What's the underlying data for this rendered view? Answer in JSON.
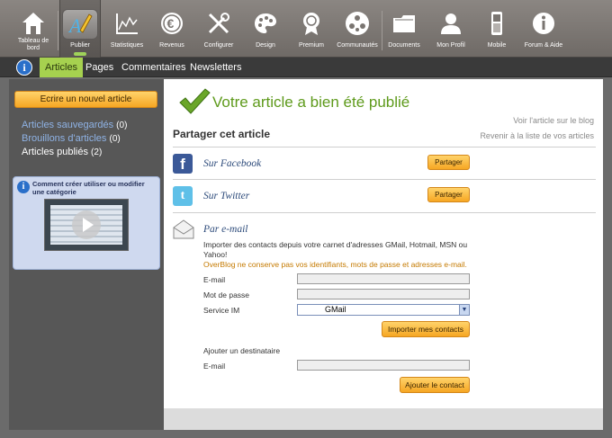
{
  "toolbar": {
    "items": [
      {
        "label": "Tableau de bord",
        "icon": "house-icon"
      },
      {
        "label": "Publier",
        "icon": "pencil-icon",
        "active": true
      },
      {
        "label": "Statistiques",
        "icon": "chart-icon"
      },
      {
        "label": "Revenus",
        "icon": "euro-icon"
      },
      {
        "label": "Configurer",
        "icon": "tools-icon"
      },
      {
        "label": "Design",
        "icon": "palette-icon"
      },
      {
        "label": "Premium",
        "icon": "medal-icon"
      },
      {
        "label": "Communautés",
        "icon": "community-icon"
      },
      {
        "label": "Documents",
        "icon": "folder-icon"
      },
      {
        "label": "Mon Profil",
        "icon": "user-icon"
      },
      {
        "label": "Mobile",
        "icon": "phone-icon"
      },
      {
        "label": "Forum & Aide",
        "icon": "info-icon"
      }
    ]
  },
  "subnav": {
    "info": "i",
    "tabs": [
      {
        "label": "Articles",
        "active": true
      },
      {
        "label": "Pages"
      },
      {
        "label": "Commentaires"
      },
      {
        "label": "Newsletters"
      }
    ]
  },
  "sidebar": {
    "new_button": "Ecrire un nouvel article",
    "links": [
      {
        "label": "Articles sauvegardés",
        "count": "(0)"
      },
      {
        "label": "Brouillons d'articles",
        "count": "(0)"
      },
      {
        "label": "Articles publiés",
        "count": "(2)",
        "current": true
      }
    ],
    "help": {
      "icon": "i",
      "text": "Comment créer utiliser ou modifier une catégorie"
    }
  },
  "main": {
    "title": "Votre article a bien été publié",
    "link_view": "Voir l'article sur le blog",
    "link_back": "Revenir à la liste de vos articles",
    "share_title": "Partager cet article",
    "facebook": {
      "label": "Sur Facebook",
      "icon_text": "f",
      "button": "Partager"
    },
    "twitter": {
      "label": "Sur Twitter",
      "icon_text": "t",
      "button": "Partager"
    },
    "email": {
      "title": "Par e-mail",
      "description": "Importer des contacts depuis votre carnet d'adresses GMail, Hotmail, MSN ou Yahoo!",
      "warning": "OverBlog ne conserve pas vos identifiants, mots de passe et adresses e-mail.",
      "email_label": "E-mail",
      "password_label": "Mot de passe",
      "service_label": "Service IM",
      "service_value": "GMail",
      "import_button": "Importer mes contacts",
      "add_recipient": "Ajouter un destinataire",
      "recipient_email_label": "E-mail",
      "add_contact_button": "Ajouter le contact"
    }
  },
  "colors": {
    "accent_green": "#a6d14f",
    "title_green": "#5e9a1b",
    "button_orange": "#f6a623",
    "link_blue": "#8fb3e6"
  }
}
